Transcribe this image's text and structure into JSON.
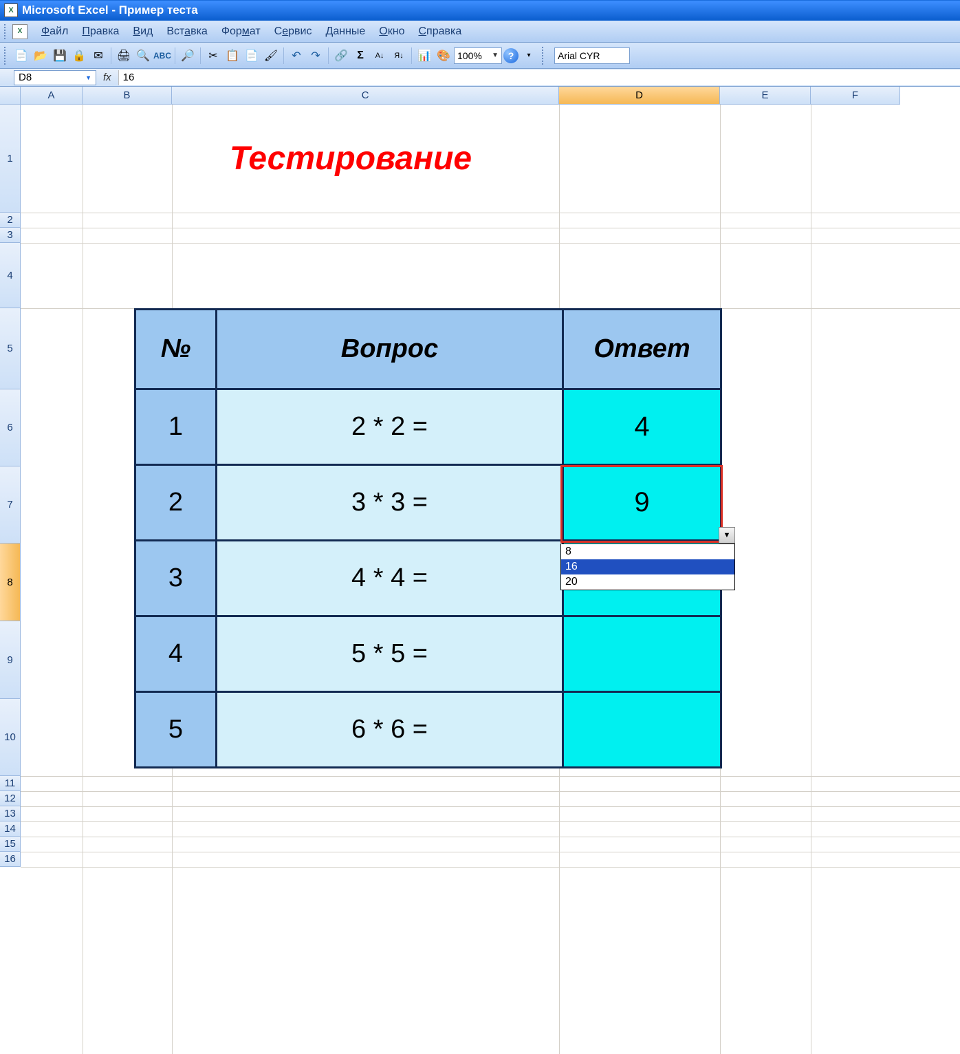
{
  "titlebar": {
    "app": "Microsoft Excel",
    "doc": "Пример теста"
  },
  "menu": {
    "items": [
      "Файл",
      "Правка",
      "Вид",
      "Вставка",
      "Формат",
      "Сервис",
      "Данные",
      "Окно",
      "Справка"
    ]
  },
  "toolbar": {
    "zoom": "100%",
    "font": "Arial CYR"
  },
  "formula": {
    "cell_ref": "D8",
    "fx_label": "fx",
    "value": "16"
  },
  "columns": [
    "A",
    "B",
    "C",
    "D",
    "E",
    "F"
  ],
  "rows": [
    "1",
    "2",
    "3",
    "4",
    "5",
    "6",
    "7",
    "8",
    "9",
    "10",
    "11",
    "12",
    "13",
    "14",
    "15",
    "16"
  ],
  "selected_col": "D",
  "selected_row": "8",
  "sheet": {
    "title": "Тестирование",
    "headers": {
      "num": "№",
      "question": "Вопрос",
      "answer": "Ответ"
    },
    "rows": [
      {
        "n": "1",
        "q": "2 * 2 =",
        "a": "4"
      },
      {
        "n": "2",
        "q": "3 * 3 =",
        "a": "9"
      },
      {
        "n": "3",
        "q": "4 * 4 =",
        "a": "16"
      },
      {
        "n": "4",
        "q": "5 * 5 =",
        "a": ""
      },
      {
        "n": "5",
        "q": "6 * 6 =",
        "a": ""
      }
    ]
  },
  "dropdown": {
    "options": [
      "8",
      "16",
      "20"
    ],
    "highlighted": "16"
  }
}
